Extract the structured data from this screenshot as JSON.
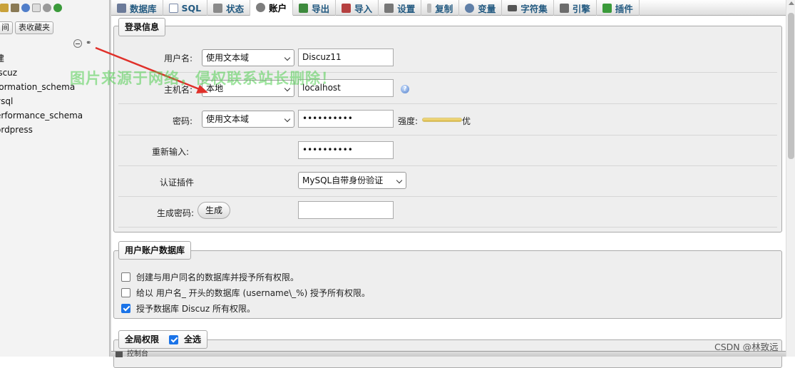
{
  "nav": {
    "tabs": [
      {
        "label": "间"
      },
      {
        "label": "表收藏夹"
      }
    ],
    "tree": [
      {
        "label": "建"
      },
      {
        "label": "iscuz"
      },
      {
        "label": "formation_schema"
      },
      {
        "label": "ysql"
      },
      {
        "label": "erformance_schema"
      },
      {
        "label": "ordpress"
      }
    ],
    "icons": [
      "home-icon",
      "database-icon",
      "help-icon",
      "docs-icon",
      "settings-icon",
      "reload-icon"
    ]
  },
  "tabs": [
    {
      "label": "数据库",
      "icon": "database-icon",
      "color": "#6b7a99"
    },
    {
      "label": "SQL",
      "icon": "sql-icon",
      "color": "#7a8aa8"
    },
    {
      "label": "状态",
      "icon": "status-icon",
      "color": "#8a8a8a"
    },
    {
      "label": "账户",
      "icon": "users-icon",
      "color": "#7d7d7d",
      "active": true
    },
    {
      "label": "导出",
      "icon": "export-icon",
      "color": "#3d8a3d"
    },
    {
      "label": "导入",
      "icon": "import-icon",
      "color": "#b54040"
    },
    {
      "label": "设置",
      "icon": "wrench-icon",
      "color": "#777777"
    },
    {
      "label": "复制",
      "icon": "replication-icon",
      "color": "#999999"
    },
    {
      "label": "变量",
      "icon": "variables-icon",
      "color": "#5f7fa8"
    },
    {
      "label": "字符集",
      "icon": "charset-icon",
      "color": "#555555"
    },
    {
      "label": "引擎",
      "icon": "engine-icon",
      "color": "#6c6c6c"
    },
    {
      "label": "插件",
      "icon": "plugin-icon",
      "color": "#3a9a3a"
    }
  ],
  "login": {
    "legend": "登录信息",
    "username": {
      "label": "用户名:",
      "select": "使用文本域",
      "value": "Discuz11"
    },
    "hostname": {
      "label": "主机名:",
      "select": "本地",
      "value": "localhost"
    },
    "password": {
      "label": "密码:",
      "select": "使用文本域",
      "value": "••••••••••",
      "strength_label": "强度:",
      "strength_value": "优",
      "strength": 1.0
    },
    "retype": {
      "label": "重新输入:",
      "value": "••••••••••"
    },
    "auth_plugin": {
      "label": "认证插件",
      "select": "MySQL自带身份验证"
    },
    "generate": {
      "label": "生成密码:",
      "button": "生成"
    }
  },
  "userdb": {
    "legend": "用户账户数据库",
    "options": [
      {
        "label": "创建与用户同名的数据库并授予所有权限。",
        "checked": false
      },
      {
        "label": "给以 用户名_ 开头的数据库 (username\\_%) 授予所有权限。",
        "checked": false
      },
      {
        "label": "授予数据库 Discuz 所有权限。",
        "checked": true
      }
    ]
  },
  "global_priv": {
    "legend": "全局权限",
    "select_all": "全选",
    "select_all_checked": true
  },
  "watermark": "图片来源于网络，侵权联系站长删除！",
  "footer_credit": "CSDN @林致远",
  "console_label": "控制台",
  "colors": {
    "accent": "#235a81",
    "arrow": "#e0302a",
    "watermark": "#50cd50"
  }
}
